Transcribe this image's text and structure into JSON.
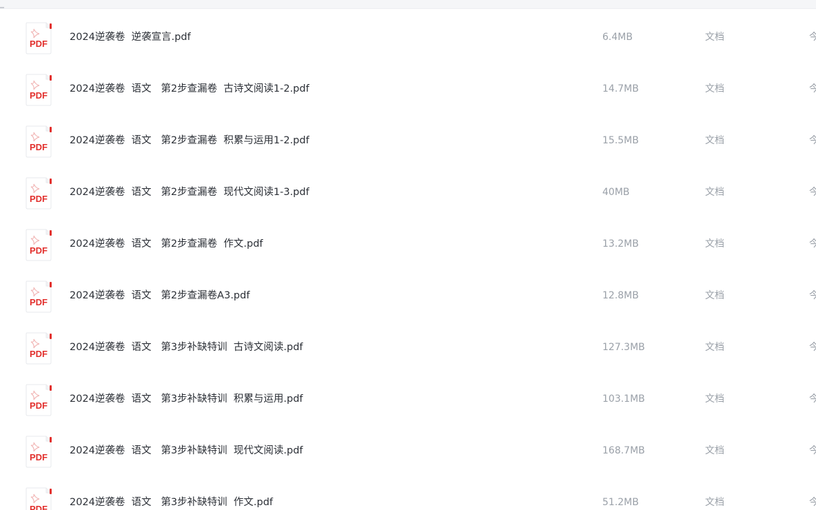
{
  "colors": {
    "pdf_red": "#e2302d",
    "text_primary": "#2b2f36",
    "text_muted": "#9aa0a8"
  },
  "icon": "pdf-file-icon",
  "pdf_label": "PDF",
  "files": [
    {
      "name": "2024逆袭卷  逆袭宣言.pdf",
      "size": "6.4MB",
      "type": "文档",
      "date": "今"
    },
    {
      "name": "2024逆袭卷  语文   第2步查漏卷  古诗文阅读1-2.pdf",
      "size": "14.7MB",
      "type": "文档",
      "date": "今"
    },
    {
      "name": "2024逆袭卷  语文   第2步查漏卷  积累与运用1-2.pdf",
      "size": "15.5MB",
      "type": "文档",
      "date": "今"
    },
    {
      "name": "2024逆袭卷  语文   第2步查漏卷  现代文阅读1-3.pdf",
      "size": "40MB",
      "type": "文档",
      "date": "今"
    },
    {
      "name": "2024逆袭卷  语文   第2步查漏卷  作文.pdf",
      "size": "13.2MB",
      "type": "文档",
      "date": "今"
    },
    {
      "name": "2024逆袭卷  语文   第2步查漏卷A3.pdf",
      "size": "12.8MB",
      "type": "文档",
      "date": "今"
    },
    {
      "name": "2024逆袭卷  语文   第3步补缺特训  古诗文阅读.pdf",
      "size": "127.3MB",
      "type": "文档",
      "date": "今"
    },
    {
      "name": "2024逆袭卷  语文   第3步补缺特训  积累与运用.pdf",
      "size": "103.1MB",
      "type": "文档",
      "date": "今"
    },
    {
      "name": "2024逆袭卷  语文   第3步补缺特训  现代文阅读.pdf",
      "size": "168.7MB",
      "type": "文档",
      "date": "今"
    },
    {
      "name": "2024逆袭卷  语文   第3步补缺特训  作文.pdf",
      "size": "51.2MB",
      "type": "文档",
      "date": "今"
    }
  ]
}
